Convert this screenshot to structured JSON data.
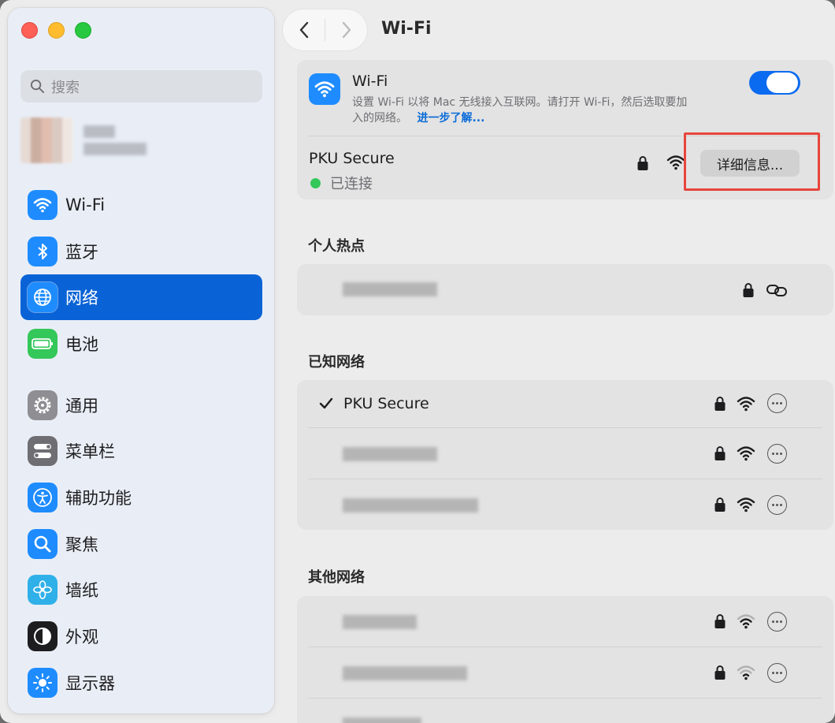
{
  "window": {
    "title": "Wi-Fi"
  },
  "sidebar": {
    "search_placeholder": "搜索",
    "items": [
      {
        "label": "Wi-Fi",
        "icon": "wifi-icon",
        "color": "#1e8cff"
      },
      {
        "label": "蓝牙",
        "icon": "bluetooth-icon",
        "color": "#1e8cff"
      },
      {
        "label": "网络",
        "icon": "globe-icon",
        "color": "#1e8cff",
        "selected": true
      },
      {
        "label": "电池",
        "icon": "battery-icon",
        "color": "#34c759"
      },
      {
        "label": "通用",
        "icon": "gear-icon",
        "color": "#8e8e93"
      },
      {
        "label": "菜单栏",
        "icon": "menubar-toggle-icon",
        "color": "#6e6e73"
      },
      {
        "label": "辅助功能",
        "icon": "accessibility-icon",
        "color": "#1e8cff"
      },
      {
        "label": "聚焦",
        "icon": "magnifier-icon",
        "color": "#1e8cff"
      },
      {
        "label": "墙纸",
        "icon": "flower-icon",
        "color": "#30b0e8"
      },
      {
        "label": "外观",
        "icon": "appearance-icon",
        "color": "#1d1d1f"
      },
      {
        "label": "显示器",
        "icon": "sun-icon",
        "color": "#1e8cff"
      }
    ]
  },
  "wifi_card": {
    "title": "Wi-Fi",
    "description_line1": "设置 Wi-Fi 以将 Mac 无线接入互联网。请打开 Wi-Fi，然后选取要加",
    "description_line2": "入的网络。",
    "learn_more": "进一步了解...",
    "toggle_on": true,
    "connected_network": "PKU Secure",
    "connected_status": "已连接",
    "status_color": "#34c759",
    "details_button": "详细信息...",
    "accent_color": "#0a6bf0"
  },
  "sections": {
    "hotspot_title": "个人热点",
    "known_title": "已知网络",
    "other_title": "其他网络"
  },
  "known_networks": [
    {
      "name": "PKU Secure",
      "checked": true
    },
    {
      "name": "",
      "checked": false
    },
    {
      "name": "",
      "checked": false
    }
  ]
}
